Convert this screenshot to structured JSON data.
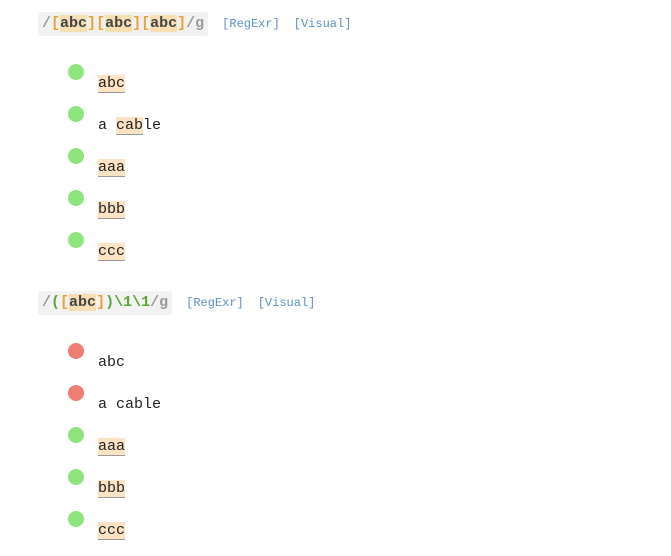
{
  "sections": [
    {
      "regex_tokens": [
        {
          "t": "/",
          "k": "slash"
        },
        {
          "t": "[",
          "k": "bracket"
        },
        {
          "t": "abc",
          "k": "class"
        },
        {
          "t": "]",
          "k": "bracket"
        },
        {
          "t": "[",
          "k": "bracket"
        },
        {
          "t": "abc",
          "k": "class"
        },
        {
          "t": "]",
          "k": "bracket"
        },
        {
          "t": "[",
          "k": "bracket"
        },
        {
          "t": "abc",
          "k": "class"
        },
        {
          "t": "]",
          "k": "bracket"
        },
        {
          "t": "/g",
          "k": "flag"
        }
      ],
      "links": {
        "regexr": "[RegExr]",
        "visual": "[Visual]"
      },
      "tests": [
        {
          "status": "pass",
          "segments": [
            {
              "t": "abc",
              "m": true
            }
          ]
        },
        {
          "status": "pass",
          "segments": [
            {
              "t": "a ",
              "m": false
            },
            {
              "t": "cab",
              "m": true
            },
            {
              "t": "le",
              "m": false
            }
          ]
        },
        {
          "status": "pass",
          "segments": [
            {
              "t": "aaa",
              "m": true
            }
          ]
        },
        {
          "status": "pass",
          "segments": [
            {
              "t": "bbb",
              "m": true
            }
          ]
        },
        {
          "status": "pass",
          "segments": [
            {
              "t": "ccc",
              "m": true
            }
          ]
        }
      ]
    },
    {
      "regex_tokens": [
        {
          "t": "/",
          "k": "slash"
        },
        {
          "t": "(",
          "k": "group"
        },
        {
          "t": "[",
          "k": "bracket"
        },
        {
          "t": "abc",
          "k": "class"
        },
        {
          "t": "]",
          "k": "bracket"
        },
        {
          "t": ")",
          "k": "group"
        },
        {
          "t": "\\1\\1",
          "k": "group"
        },
        {
          "t": "/g",
          "k": "flag"
        }
      ],
      "links": {
        "regexr": "[RegExr]",
        "visual": "[Visual]"
      },
      "tests": [
        {
          "status": "fail",
          "segments": [
            {
              "t": "abc",
              "m": false
            }
          ]
        },
        {
          "status": "fail",
          "segments": [
            {
              "t": "a cable",
              "m": false
            }
          ]
        },
        {
          "status": "pass",
          "segments": [
            {
              "t": "aaa",
              "m": true
            }
          ]
        },
        {
          "status": "pass",
          "segments": [
            {
              "t": "bbb",
              "m": true
            }
          ]
        },
        {
          "status": "pass",
          "segments": [
            {
              "t": "ccc",
              "m": true
            }
          ]
        }
      ]
    }
  ],
  "colors": {
    "pass": "#8ee57e",
    "fail": "#ee7e74",
    "link": "#5b8fd6",
    "match_bg": "#fbe3c4"
  }
}
